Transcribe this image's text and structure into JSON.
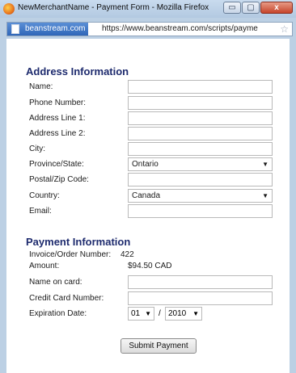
{
  "window": {
    "title": "NewMerchantName - Payment Form - Mozilla Firefox",
    "minimize_label": "▭",
    "maximize_label": "▢",
    "close_label": "x"
  },
  "urlbar": {
    "site_identity": "beanstream.com",
    "url": "https://www.beanstream.com/scripts/payme",
    "star": "☆"
  },
  "address_section": {
    "title": "Address Information",
    "fields": {
      "name": {
        "label": "Name:",
        "value": ""
      },
      "phone": {
        "label": "Phone Number:",
        "value": ""
      },
      "addr1": {
        "label": "Address Line 1:",
        "value": ""
      },
      "addr2": {
        "label": "Address Line 2:",
        "value": ""
      },
      "city": {
        "label": "City:",
        "value": ""
      },
      "province": {
        "label": "Province/State:",
        "value": "Ontario"
      },
      "postal": {
        "label": "Postal/Zip Code:",
        "value": ""
      },
      "country": {
        "label": "Country:",
        "value": "Canada"
      },
      "email": {
        "label": "Email:",
        "value": ""
      }
    }
  },
  "payment_section": {
    "title": "Payment Information",
    "invoice_label": "Invoice/Order Number:",
    "invoice_value": "422",
    "amount_label": "Amount:",
    "amount_value": "$94.50 CAD",
    "name_on_card_label": "Name on card:",
    "card_number_label": "Credit Card Number:",
    "expiration_label": "Expiration Date:",
    "exp_month": "01",
    "exp_year": "2010",
    "exp_separator": "/"
  },
  "submit_label": "Submit Payment"
}
